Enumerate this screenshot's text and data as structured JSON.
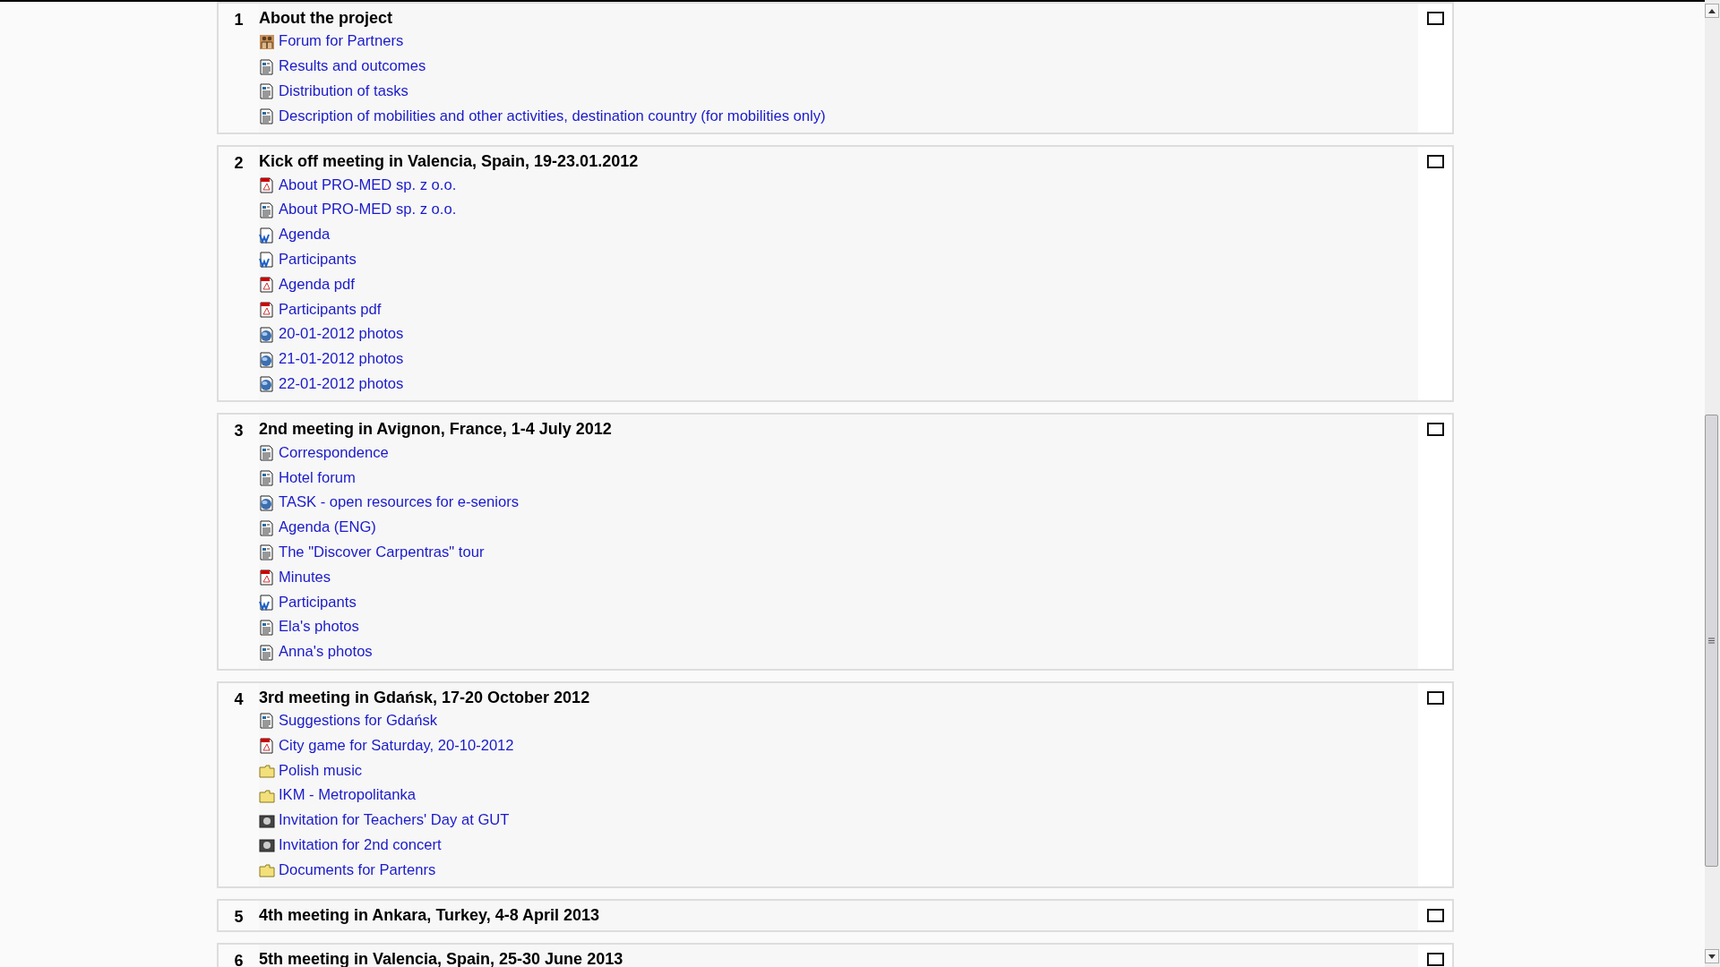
{
  "sections": [
    {
      "number": "1",
      "title": "About the project",
      "items": [
        {
          "kind": "forum",
          "label": "Forum for Partners"
        },
        {
          "kind": "page",
          "label": "Results and outcomes"
        },
        {
          "kind": "page",
          "label": "Distribution of tasks"
        },
        {
          "kind": "page",
          "label": "Description of mobilities and other activities, destination country (for mobilities only)"
        }
      ]
    },
    {
      "number": "2",
      "title": "Kick off meeting in Valencia, Spain, 19-23.01.2012",
      "items": [
        {
          "kind": "pdf",
          "label": "About PRO-MED sp. z o.o."
        },
        {
          "kind": "page",
          "label": "About PRO-MED sp. z o.o."
        },
        {
          "kind": "word",
          "label": "Agenda"
        },
        {
          "kind": "word",
          "label": "Participants"
        },
        {
          "kind": "pdf",
          "label": "Agenda pdf"
        },
        {
          "kind": "pdf",
          "label": "Participants pdf"
        },
        {
          "kind": "web",
          "label": "20-01-2012 photos"
        },
        {
          "kind": "web",
          "label": "21-01-2012 photos"
        },
        {
          "kind": "web",
          "label": "22-01-2012 photos"
        }
      ]
    },
    {
      "number": "3",
      "title": "2nd meeting in Avignon, France, 1-4 July 2012",
      "items": [
        {
          "kind": "page",
          "label": "Correspondence"
        },
        {
          "kind": "page",
          "label": "Hotel forum"
        },
        {
          "kind": "web",
          "label": "TASK - open resources for e-seniors"
        },
        {
          "kind": "page",
          "label": "Agenda (ENG)"
        },
        {
          "kind": "page",
          "label": "The \"Discover Carpentras\" tour"
        },
        {
          "kind": "pdf",
          "label": "Minutes"
        },
        {
          "kind": "word",
          "label": "Participants"
        },
        {
          "kind": "page",
          "label": "Ela's photos"
        },
        {
          "kind": "page",
          "label": "Anna's photos"
        }
      ]
    },
    {
      "number": "4",
      "title": "3rd meeting in Gdańsk, 17-20 October 2012",
      "items": [
        {
          "kind": "page",
          "label": "Suggestions for Gdańsk"
        },
        {
          "kind": "pdf",
          "label": "City game for Saturday, 20-10-2012"
        },
        {
          "kind": "folder",
          "label": "Polish music"
        },
        {
          "kind": "folder",
          "label": "IKM - Metropolitanka"
        },
        {
          "kind": "image",
          "label": "Invitation for Teachers' Day at GUT"
        },
        {
          "kind": "image",
          "label": "Invitation for 2nd concert"
        },
        {
          "kind": "folder",
          "label": "Documents for Partenrs"
        }
      ]
    },
    {
      "number": "5",
      "title": "4th meeting in Ankara, Turkey, 4-8 April 2013"
    },
    {
      "number": "6",
      "title": "5th meeting in Valencia, Spain, 25-30 June 2013"
    }
  ]
}
